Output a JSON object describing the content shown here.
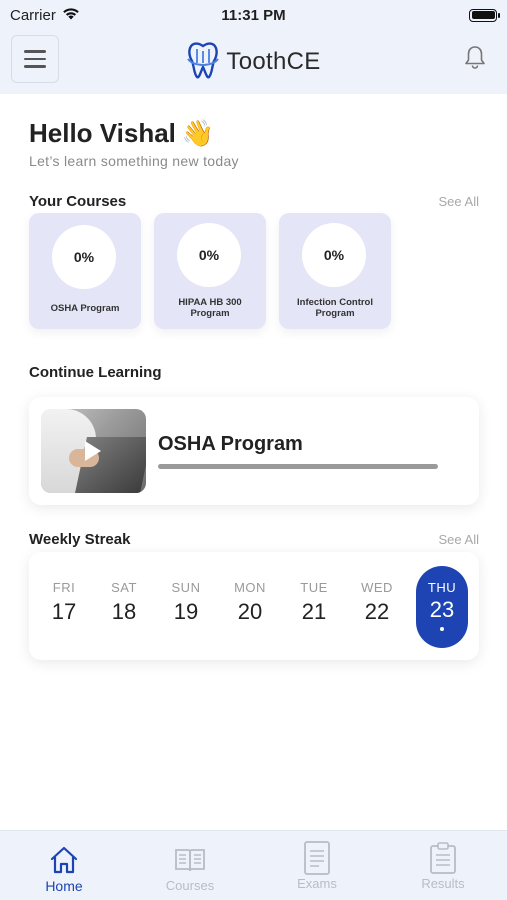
{
  "status_bar": {
    "carrier": "Carrier",
    "time": "11:31 PM"
  },
  "header": {
    "app_name": "ToothCE",
    "menu_icon": "hamburger-icon",
    "notification_icon": "bell-icon",
    "logo_icon": "tooth-logo-icon"
  },
  "greeting": {
    "title": "Hello Vishal",
    "emoji": "👋",
    "subtitle": "Let’s learn something new today"
  },
  "courses": {
    "title": "Your Courses",
    "see_all": "See All",
    "items": [
      {
        "progress": "0%",
        "name": "OSHA Program"
      },
      {
        "progress": "0%",
        "name": "HIPAA HB 300 Program"
      },
      {
        "progress": "0%",
        "name": "Infection Control Program"
      }
    ]
  },
  "continue_learning": {
    "title": "Continue Learning",
    "course": "OSHA Program",
    "progress_fraction": 0.0
  },
  "weekly_streak": {
    "title": "Weekly Streak",
    "see_all": "See All",
    "days": [
      {
        "name": "FRI",
        "num": "17"
      },
      {
        "name": "SAT",
        "num": "18"
      },
      {
        "name": "SUN",
        "num": "19"
      },
      {
        "name": "MON",
        "num": "20"
      },
      {
        "name": "TUE",
        "num": "21"
      },
      {
        "name": "WED",
        "num": "22"
      },
      {
        "name": "THU",
        "num": "23",
        "active": true
      }
    ]
  },
  "tabs": [
    {
      "label": "Home",
      "icon": "home-icon",
      "active": true
    },
    {
      "label": "Courses",
      "icon": "book-icon"
    },
    {
      "label": "Exams",
      "icon": "document-icon"
    },
    {
      "label": "Results",
      "icon": "clipboard-icon"
    }
  ],
  "colors": {
    "accent": "#1d44b2",
    "header_bg": "#eef3fb",
    "course_card_bg": "#e4e5f6"
  }
}
